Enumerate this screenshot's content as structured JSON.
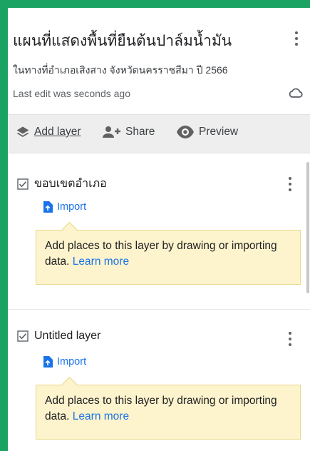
{
  "map": {
    "title": "แผนที่แสดงพื้นที่ยืนต้นปาล์มน้ำมัน",
    "description": "ในทางที่อำเภอเสิงสาง จังหวัดนครราชสีมา ปี 2566",
    "last_edit": "Last edit was seconds ago"
  },
  "toolbar": {
    "add_layer": "Add layer",
    "share": "Share",
    "preview": "Preview"
  },
  "layers": [
    {
      "name": "ขอบเขตอำเภอ",
      "checked": true,
      "import_label": "Import",
      "tip_text": "Add places to this layer by drawing or importing data.",
      "learn_more": "Learn more"
    },
    {
      "name": "Untitled layer",
      "checked": true,
      "import_label": "Import",
      "tip_text": "Add places to this layer by drawing or importing data.",
      "learn_more": "Learn more"
    }
  ],
  "icons": {
    "options": "more-vert-icon",
    "saved": "cloud-done-icon",
    "add_layer": "layers-icon",
    "share": "person-add-icon",
    "preview": "eye-icon",
    "checkbox": "checkbox-checked-icon",
    "import": "file-upload-icon"
  },
  "colors": {
    "frame": "#1ba363",
    "link": "#1a73e8",
    "tip_bg": "#fdf3cc"
  }
}
